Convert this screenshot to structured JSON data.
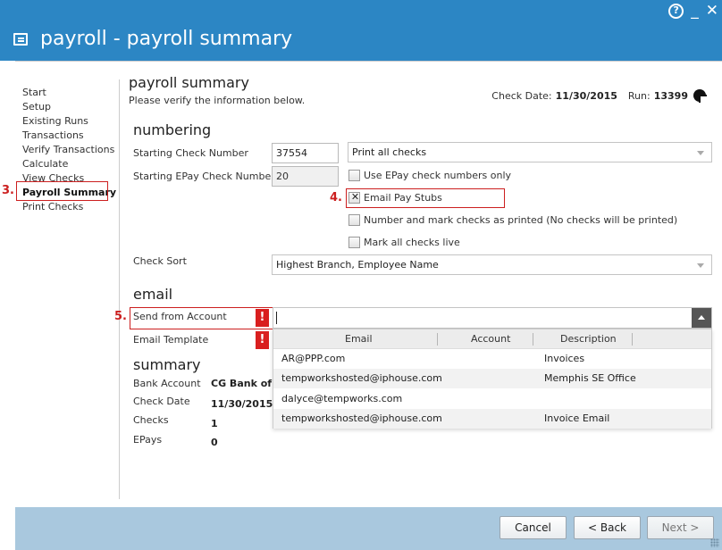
{
  "window": {
    "title": "payroll - payroll summary",
    "help_icon": "question-circle-icon",
    "minimize_label": "_",
    "close_label": "✕"
  },
  "sidebar": {
    "items": [
      {
        "label": "Start"
      },
      {
        "label": "Setup"
      },
      {
        "label": "Existing Runs"
      },
      {
        "label": "Transactions"
      },
      {
        "label": "Verify Transactions"
      },
      {
        "label": "Calculate"
      },
      {
        "label": "View Checks"
      },
      {
        "label": "Payroll Summary",
        "active": true
      },
      {
        "label": "Print Checks"
      }
    ]
  },
  "annotations": {
    "step3": "3.",
    "step4": "4.",
    "step5": "5.",
    "color": "#cc1f1f"
  },
  "header": {
    "title": "payroll summary",
    "subtitle": "Please verify the information below.",
    "check_date_label": "Check Date:",
    "check_date_value": "11/30/2015",
    "run_label": "Run:",
    "run_value": "13399"
  },
  "numbering": {
    "heading": "numbering",
    "starting_check_label": "Starting Check Number",
    "starting_check_value": "37554",
    "print_option": "Print all checks",
    "starting_epay_label": "Starting EPay Check Number",
    "starting_epay_value": "20",
    "use_epay_only_label": "Use EPay check numbers only",
    "email_pay_stubs_label": "Email Pay Stubs",
    "number_and_mark_label": "Number and mark checks as printed (No checks will be printed)",
    "mark_live_label": "Mark all checks live",
    "check_sort_label": "Check Sort",
    "check_sort_value": "Highest Branch, Employee Name"
  },
  "email": {
    "heading": "email",
    "send_from_label": "Send from Account",
    "template_label": "Email Template",
    "error_mark": "!",
    "dropdown": {
      "columns": [
        "Email",
        "Account",
        "Description"
      ],
      "rows": [
        {
          "email": "AR@PPP.com",
          "account": "",
          "description": "Invoices"
        },
        {
          "email": "tempworkshosted@iphouse.com",
          "account": "",
          "description": "Memphis SE Office"
        },
        {
          "email": "dalyce@tempworks.com",
          "account": "",
          "description": ""
        },
        {
          "email": "tempworkshosted@iphouse.com",
          "account": "",
          "description": "Invoice Email"
        }
      ]
    }
  },
  "summary": {
    "heading": "summary",
    "bank_account_label": "Bank Account",
    "bank_account_value": "CG Bank of A",
    "check_date_label": "Check Date",
    "check_date_value": "11/30/2015",
    "checks_label": "Checks",
    "checks_value": "1",
    "epays_label": "EPays",
    "epays_value": "0"
  },
  "footer": {
    "cancel_label": "Cancel",
    "back_label": "< Back",
    "next_label": "Next >"
  },
  "colors": {
    "titlebar": "#2c86c4",
    "footer": "#a9c8de",
    "error": "#d91f1f"
  }
}
